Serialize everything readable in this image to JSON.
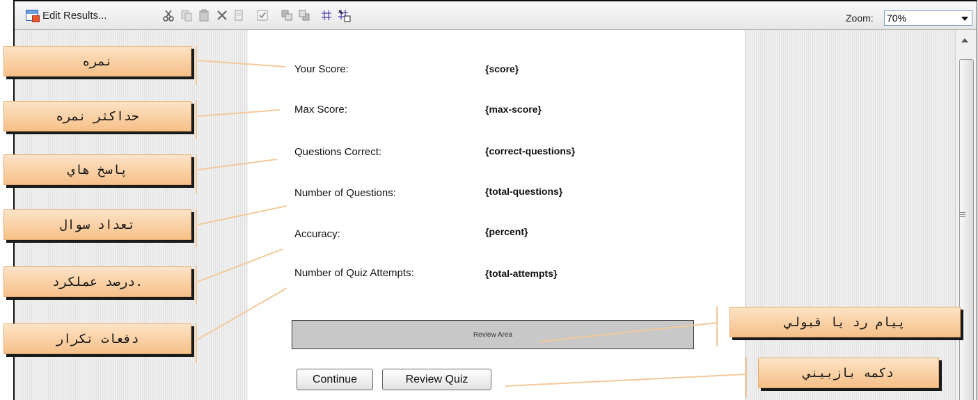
{
  "toolbar": {
    "edit_results_label": "Edit Results...",
    "zoom_label": "Zoom:",
    "zoom_value": "70%"
  },
  "results": {
    "rows": [
      {
        "label": "Your Score:",
        "value": "{score}"
      },
      {
        "label": "Max Score:",
        "value": "{max-score}"
      },
      {
        "label": "Questions Correct:",
        "value": "{correct-questions}"
      },
      {
        "label": "Number of Questions:",
        "value": "{total-questions}"
      },
      {
        "label": "Accuracy:",
        "value": "{percent}"
      },
      {
        "label": "Number of Quiz Attempts:",
        "value": "{total-attempts}"
      }
    ],
    "review_area_label": "Review Area",
    "continue_label": "Continue",
    "review_quiz_label": "Review Quiz"
  },
  "callouts": {
    "score": "نمره",
    "max_score": "حداكثر نمره",
    "correct": "پاسخ هاي",
    "total_questions": "تعداد سوال",
    "percent": "درصد عملكرد.",
    "attempts": "دفعات تكرار",
    "review_message": "پيام رد يا قبولي",
    "review_button": "دكمه بازبيني"
  },
  "colors": {
    "callout_fill": "#f6c088",
    "leader_line": "#f2c89a",
    "review_area_fill": "#c8c8c8"
  }
}
